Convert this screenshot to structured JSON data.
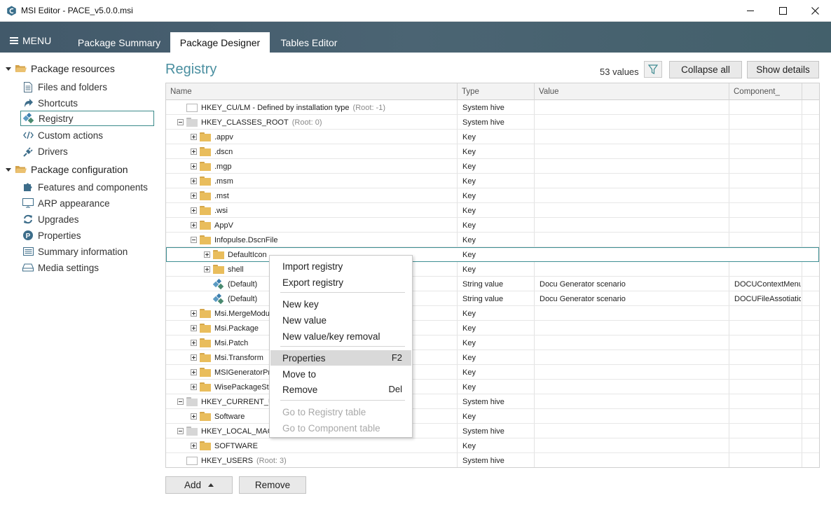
{
  "window": {
    "title": "MSI Editor - PACE_v5.0.0.msi",
    "min_icon": "minimize-icon",
    "max_icon": "maximize-icon",
    "close_icon": "close-icon"
  },
  "menubar": {
    "menu_label": "MENU",
    "tabs": [
      {
        "label": "Package Summary"
      },
      {
        "label": "Package Designer"
      },
      {
        "label": "Tables Editor"
      }
    ],
    "active_tab": "Package Designer"
  },
  "sidebar": {
    "groups": [
      {
        "label": "Package resources",
        "items": [
          {
            "label": "Files and folders",
            "icon": "file-icon"
          },
          {
            "label": "Shortcuts",
            "icon": "shortcut-arrow-icon"
          },
          {
            "label": "Registry",
            "icon": "registry-icon"
          },
          {
            "label": "Custom actions",
            "icon": "code-icon"
          },
          {
            "label": "Drivers",
            "icon": "plug-icon"
          }
        ]
      },
      {
        "label": "Package configuration",
        "items": [
          {
            "label": "Features and components",
            "icon": "puzzle-icon"
          },
          {
            "label": "ARP appearance",
            "icon": "monitor-icon"
          },
          {
            "label": "Upgrades",
            "icon": "refresh-icon"
          },
          {
            "label": "Properties",
            "icon": "p-circle-icon"
          },
          {
            "label": "Summary information",
            "icon": "list-icon"
          },
          {
            "label": "Media settings",
            "icon": "drive-icon"
          }
        ]
      }
    ],
    "selected": "Registry"
  },
  "main": {
    "title": "Registry",
    "values_count": "53 values",
    "collapse_all": "Collapse all",
    "show_details": "Show details",
    "add_label": "Add",
    "remove_label": "Remove"
  },
  "grid": {
    "columns": [
      "Name",
      "Type",
      "Value",
      "Component_"
    ],
    "rows": [
      {
        "name": "HKEY_CU/LM - Defined by installation type",
        "note": "(Root: -1)",
        "type": "System hive",
        "value": "",
        "component": "",
        "level": 0,
        "expander": "none",
        "icon": "white"
      },
      {
        "name": "HKEY_CLASSES_ROOT",
        "note": "(Root: 0)",
        "type": "System hive",
        "value": "",
        "component": "",
        "level": 0,
        "expander": "minus",
        "icon": "gray"
      },
      {
        "name": ".appv",
        "note": "",
        "type": "Key",
        "value": "",
        "component": "",
        "level": 1,
        "expander": "plus",
        "icon": "yellow"
      },
      {
        "name": ".dscn",
        "note": "",
        "type": "Key",
        "value": "",
        "component": "",
        "level": 1,
        "expander": "plus",
        "icon": "yellow"
      },
      {
        "name": ".mgp",
        "note": "",
        "type": "Key",
        "value": "",
        "component": "",
        "level": 1,
        "expander": "plus",
        "icon": "yellow"
      },
      {
        "name": ".msm",
        "note": "",
        "type": "Key",
        "value": "",
        "component": "",
        "level": 1,
        "expander": "plus",
        "icon": "yellow"
      },
      {
        "name": ".mst",
        "note": "",
        "type": "Key",
        "value": "",
        "component": "",
        "level": 1,
        "expander": "plus",
        "icon": "yellow"
      },
      {
        "name": ".wsi",
        "note": "",
        "type": "Key",
        "value": "",
        "component": "",
        "level": 1,
        "expander": "plus",
        "icon": "yellow"
      },
      {
        "name": "AppV",
        "note": "",
        "type": "Key",
        "value": "",
        "component": "",
        "level": 1,
        "expander": "plus",
        "icon": "yellow"
      },
      {
        "name": "Infopulse.DscnFile",
        "note": "",
        "type": "Key",
        "value": "",
        "component": "",
        "level": 1,
        "expander": "minus",
        "icon": "yellow"
      },
      {
        "name": "DefaultIcon",
        "note": "",
        "type": "Key",
        "value": "",
        "component": "",
        "level": 2,
        "expander": "plus",
        "icon": "yellow",
        "selected": true
      },
      {
        "name": "shell",
        "note": "",
        "type": "Key",
        "value": "",
        "component": "",
        "level": 2,
        "expander": "plus",
        "icon": "yellow"
      },
      {
        "name": "(Default)",
        "note": "",
        "type": "String value",
        "value": "Docu Generator scenario",
        "component": "DOCUContextMenu",
        "level": 2,
        "expander": "none",
        "icon": "value"
      },
      {
        "name": "(Default)",
        "note": "",
        "type": "String value",
        "value": "Docu Generator scenario",
        "component": "DOCUFileAssotiatio",
        "level": 2,
        "expander": "none",
        "icon": "value"
      },
      {
        "name": "Msi.MergeModu",
        "note": "",
        "type": "Key",
        "value": "",
        "component": "",
        "level": 1,
        "expander": "plus",
        "icon": "yellow"
      },
      {
        "name": "Msi.Package",
        "note": "",
        "type": "Key",
        "value": "",
        "component": "",
        "level": 1,
        "expander": "plus",
        "icon": "yellow"
      },
      {
        "name": "Msi.Patch",
        "note": "",
        "type": "Key",
        "value": "",
        "component": "",
        "level": 1,
        "expander": "plus",
        "icon": "yellow"
      },
      {
        "name": "Msi.Transform",
        "note": "",
        "type": "Key",
        "value": "",
        "component": "",
        "level": 1,
        "expander": "plus",
        "icon": "yellow"
      },
      {
        "name": "MSIGeneratorPro",
        "note": "",
        "type": "Key",
        "value": "",
        "component": "",
        "level": 1,
        "expander": "plus",
        "icon": "yellow"
      },
      {
        "name": "WisePackageStu",
        "note": "",
        "type": "Key",
        "value": "",
        "component": "",
        "level": 1,
        "expander": "plus",
        "icon": "yellow"
      },
      {
        "name": "HKEY_CURRENT_USE",
        "note": "",
        "type": "System hive",
        "value": "",
        "component": "",
        "level": 0,
        "expander": "minus",
        "icon": "gray"
      },
      {
        "name": "Software",
        "note": "",
        "type": "Key",
        "value": "",
        "component": "",
        "level": 1,
        "expander": "plus",
        "icon": "yellow"
      },
      {
        "name": "HKEY_LOCAL_MACH",
        "note": "",
        "type": "System hive",
        "value": "",
        "component": "",
        "level": 0,
        "expander": "minus",
        "icon": "gray"
      },
      {
        "name": "SOFTWARE",
        "note": "",
        "type": "Key",
        "value": "",
        "component": "",
        "level": 1,
        "expander": "plus",
        "icon": "yellow"
      },
      {
        "name": "HKEY_USERS",
        "note": "(Root: 3)",
        "type": "System hive",
        "value": "",
        "component": "",
        "level": 0,
        "expander": "none",
        "icon": "white"
      }
    ]
  },
  "context_menu": {
    "items": [
      {
        "label": "Import registry",
        "shortcut": ""
      },
      {
        "label": "Export registry",
        "shortcut": ""
      },
      {
        "label": "New key",
        "shortcut": ""
      },
      {
        "label": "New value",
        "shortcut": ""
      },
      {
        "label": "New value/key removal",
        "shortcut": ""
      },
      {
        "label": "Properties",
        "shortcut": "F2"
      },
      {
        "label": "Move to",
        "shortcut": ""
      },
      {
        "label": "Remove",
        "shortcut": "Del"
      },
      {
        "label": "Go to Registry table",
        "shortcut": ""
      },
      {
        "label": "Go to Component table",
        "shortcut": ""
      }
    ],
    "highlighted": "Properties"
  },
  "colors": {
    "menubar": "#435a68",
    "accent": "#4a8fa0",
    "folder": "#e9bd5c"
  }
}
